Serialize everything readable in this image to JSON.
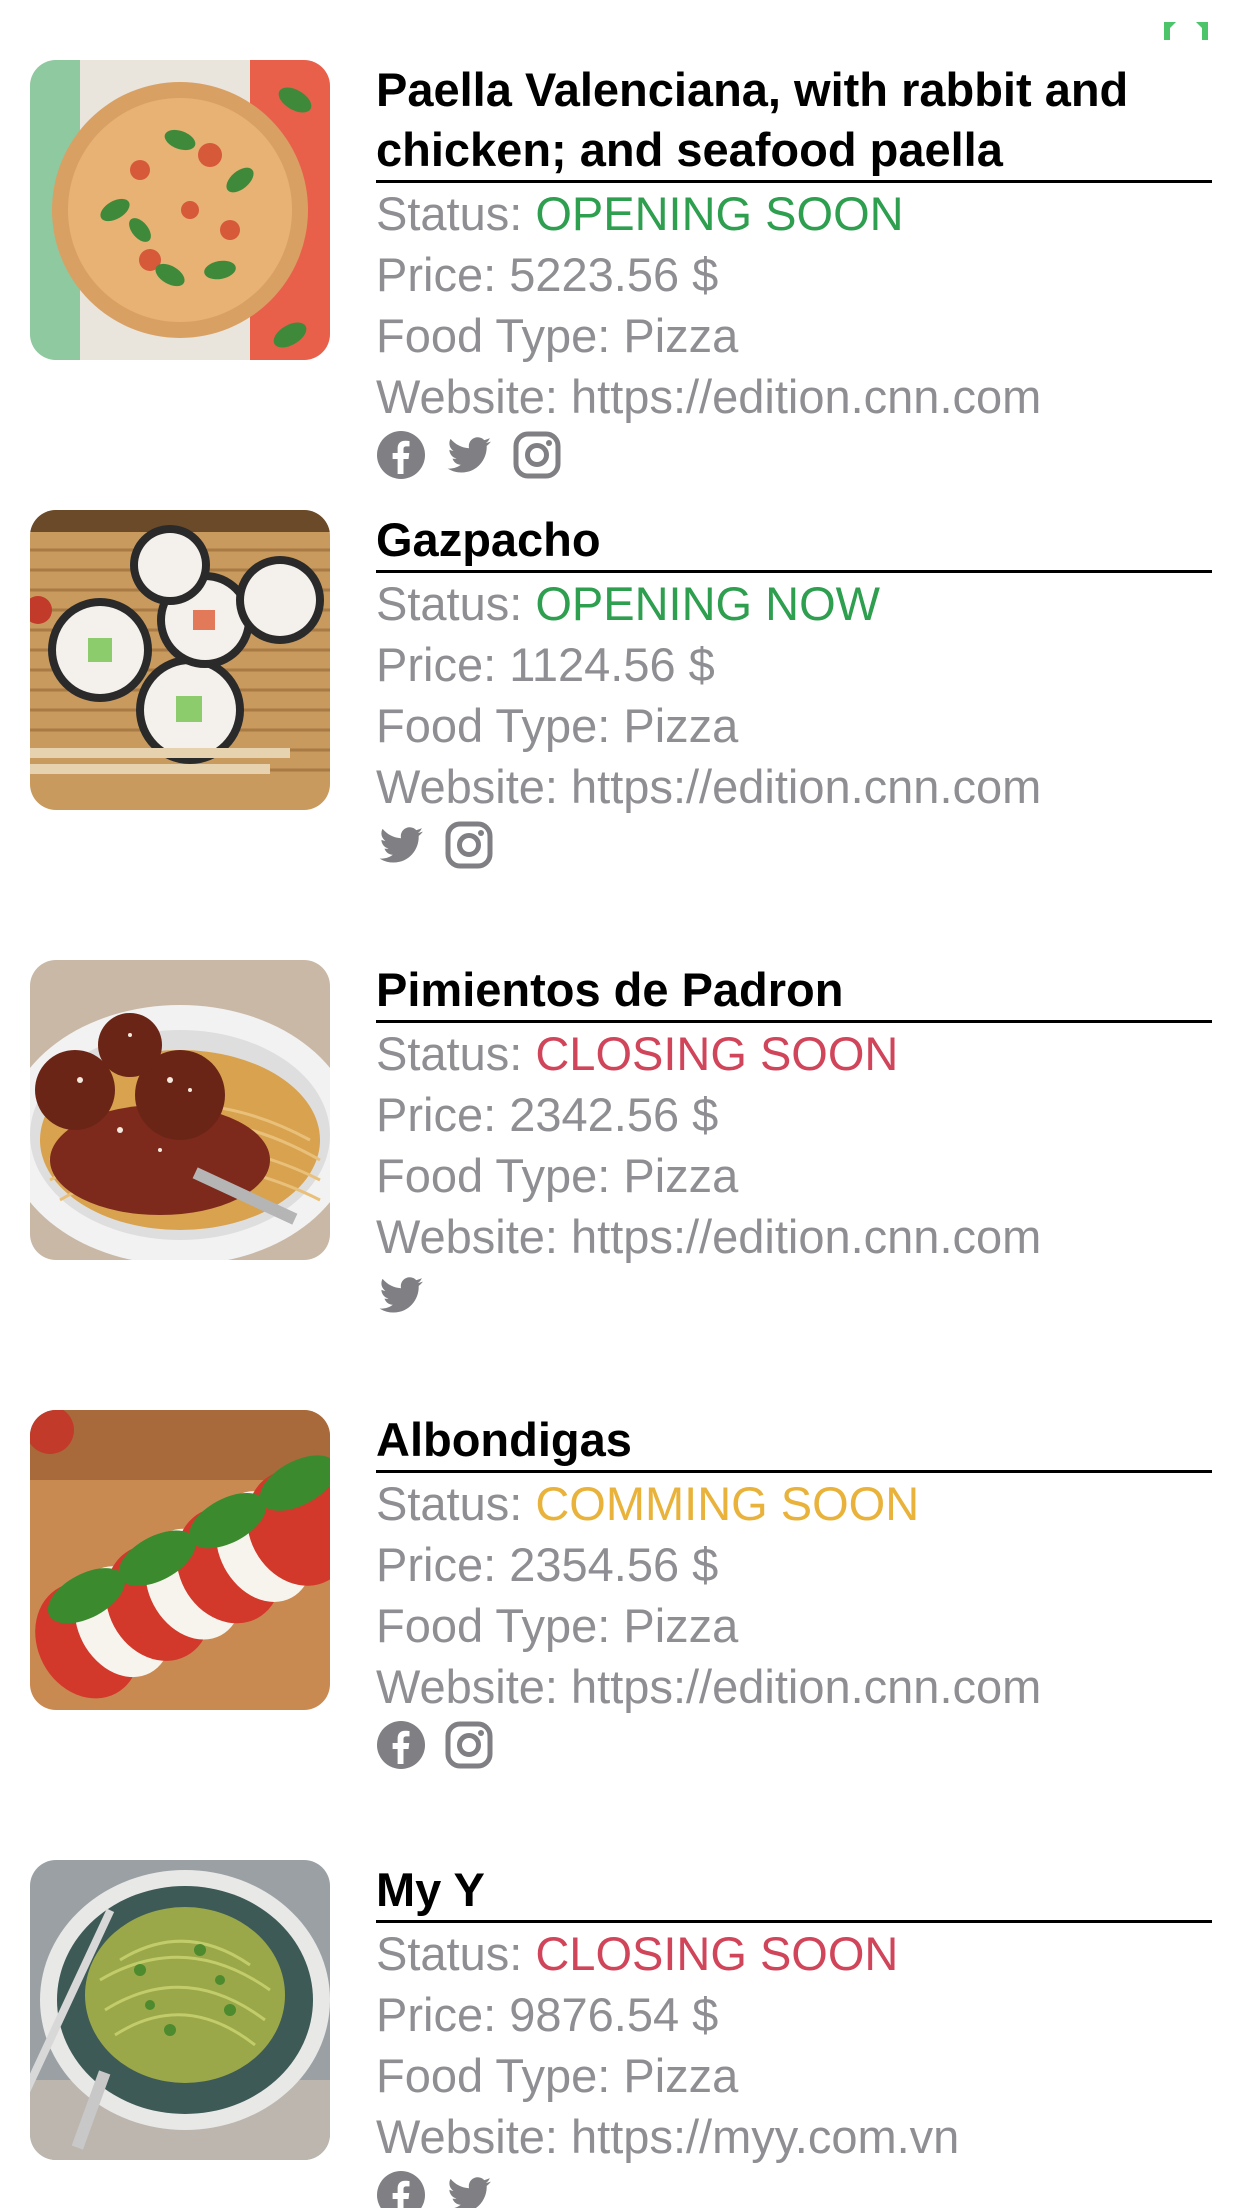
{
  "labels": {
    "status": "Status: ",
    "price": "Price: ",
    "food_type": "Food Type: ",
    "website": "Website: "
  },
  "colors": {
    "opening": "#2e9e4f",
    "closing": "#d1455a",
    "coming": "#e9b23b",
    "gray": "#8e8e93",
    "icon": "#7f7f84"
  },
  "items": [
    {
      "name": "Paella Valenciana, with rabbit and chicken; and seafood paella",
      "status": "OPENING SOON",
      "status_color": "#2e9e4f",
      "price": "5223.56 $",
      "food_type": "Pizza",
      "website": "https://edition.cnn.com",
      "image": "pizza-image",
      "socials": [
        "facebook-icon",
        "twitter-icon",
        "instagram-icon"
      ]
    },
    {
      "name": "Gazpacho",
      "status": "OPENING NOW",
      "status_color": "#2e9e4f",
      "price": "1124.56 $",
      "food_type": "Pizza",
      "website": "https://edition.cnn.com",
      "image": "sushi-image",
      "socials": [
        "twitter-icon",
        "instagram-icon"
      ]
    },
    {
      "name": "Pimientos de Padron",
      "status": "CLOSING SOON",
      "status_color": "#d1455a",
      "price": "2342.56 $",
      "food_type": "Pizza",
      "website": "https://edition.cnn.com",
      "image": "meatball-spaghetti-image",
      "socials": [
        "twitter-icon"
      ]
    },
    {
      "name": "Albondigas",
      "status": "COMMING SOON",
      "status_color": "#e9b23b",
      "price": "2354.56 $",
      "food_type": "Pizza",
      "website": "https://edition.cnn.com",
      "image": "caprese-image",
      "socials": [
        "facebook-icon",
        "instagram-icon"
      ]
    },
    {
      "name": "My Y",
      "status": "CLOSING SOON",
      "status_color": "#d1455a",
      "price": "9876.54 $",
      "food_type": "Pizza",
      "website": "https://myy.com.vn",
      "image": "pesto-pasta-image",
      "socials": [
        "facebook-icon",
        "twitter-icon"
      ]
    }
  ]
}
